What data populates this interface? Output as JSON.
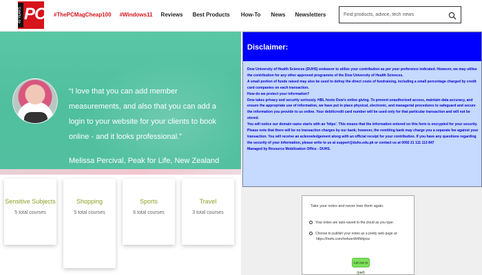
{
  "nav": {
    "logo_text": "PC",
    "logo_badge": "40 YEARS",
    "links": [
      "#ThePCMagCheap100",
      "#Windows11",
      "Reviews",
      "Best Products",
      "How-To",
      "News",
      "Newsletters"
    ],
    "search_placeholder": "Find products, advice, tech news",
    "accent_color": "#d6141a"
  },
  "testimonial": {
    "quote": "“I love that you can add member measurements, and also that you can add a login to your website for your clients to book online - and it looks professional.”",
    "author": "Melissa Percival, Peak for Life, New Zealand",
    "bg_color": "#53c1a0"
  },
  "courses": [
    {
      "title": "Sensitive Subjects",
      "count": "5 total courses"
    },
    {
      "title": "Shopping",
      "count": "5 total courses"
    },
    {
      "title": "Sports",
      "count": "6 total courses"
    },
    {
      "title": "Travel",
      "count": "3 total courses"
    }
  ],
  "disclaimer": {
    "title": "Disclaimer:",
    "header_color": "#0000ff",
    "body_color": "#c6d9ff",
    "lines": [
      "Dow University of Health Sciences (DUHS) endeavor to utilize your contribution as per your preference indicated. However, we may utilise the contribution for any other approved programme of the Dow University of Health Sciences.",
      "A small portion of funds raised may also be used to defray the direct costs of fundraising, including a small percentage charged by credit card companies on each transaction.",
      "How do we protect your information?",
      "Dow takes privacy and security seriously. HBL hosts Dow's online giving. To prevent unauthorized access, maintain data accuracy, and ensure the appropriate use of information, we have put in place physical, electronic, and managerial procedures to safeguard and secure the information you provide to us online. Your debit/credit card number will be used only for that particular transaction and will not be stored.",
      "You will notice our domain name starts with an 'https'. This means that the information entered on this form is encrypted for your security.",
      "Please note that there will be no transaction charges by our bank; however, the remitting bank may charge you a separate fee against your transaction. You will receive an acknowledgement along with an official receipt for your contribution. If you have any questions regarding the security of your information, please write to us at support@duhs.edu.pk or contact us at 0092 21 111 113 847",
      "Managed by Resource Mobilization Office - DUHS."
    ]
  },
  "notes_widget": {
    "heading": "Take your notes and never lose them again.",
    "item1": "Your notes are auto-saved to the cloud as you type.",
    "item2": "Choose to publish your notes as a pretty web page at",
    "item2_url": "https://hrefs.com/#e4unnW4N4pcw",
    "button_label": "Let me in (pad)"
  }
}
